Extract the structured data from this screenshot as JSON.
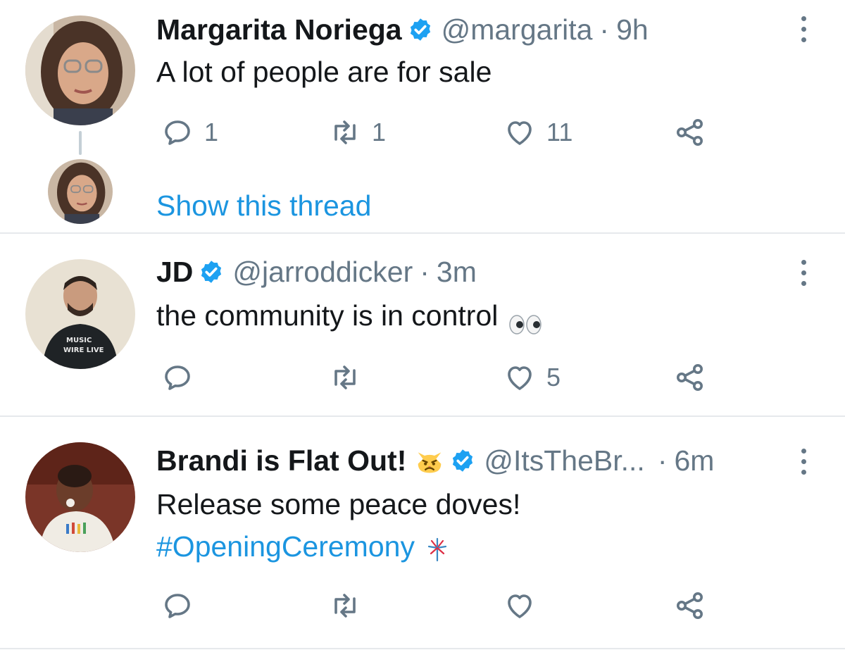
{
  "tweets": [
    {
      "name": "Margarita Noriega",
      "handle": "@margarita",
      "separator": "·",
      "time": "9h",
      "text": "A lot of people are for sale",
      "reply_count": "1",
      "retweet_count": "1",
      "like_count": "11",
      "thread_link": "Show this thread"
    },
    {
      "name": "JD",
      "handle": "@jarroddicker",
      "separator": "·",
      "time": "3m",
      "text": "the community is in control",
      "text_emoji": "eyes-emoji",
      "like_count": "5"
    },
    {
      "name": "Brandi is Flat Out!",
      "name_emoji": "pouting-cat-emoji",
      "handle": "@ItsTheBr...",
      "separator": "·",
      "time": "6m",
      "text": "Release some peace doves!",
      "hashtag": "#OpeningCeremony",
      "hashtag_emoji": "fireworks-emoji"
    }
  ],
  "colors": {
    "link": "#1b95e0",
    "muted": "#657786",
    "verified": "#1da1f2",
    "divider": "#e6e9ec"
  },
  "icons": [
    "reply-icon",
    "retweet-icon",
    "like-icon",
    "share-icon",
    "more-icon",
    "verified-badge-icon"
  ]
}
